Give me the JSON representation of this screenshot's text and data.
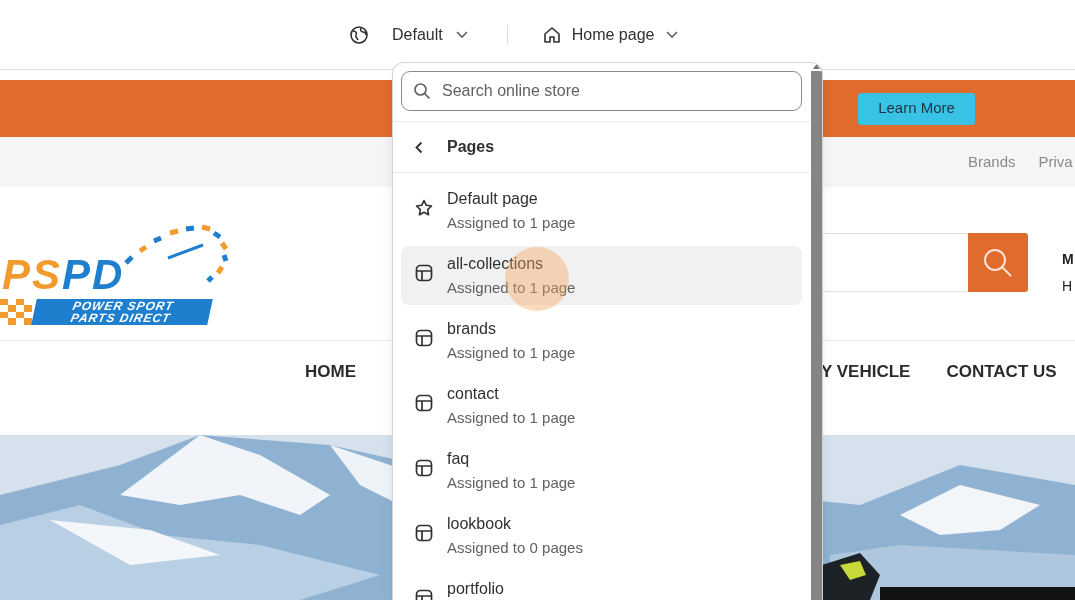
{
  "toolbar": {
    "theme": {
      "label": "Default"
    },
    "template": {
      "label": "Home page"
    }
  },
  "site": {
    "announcement": {
      "button": "Learn More"
    },
    "top_links": [
      "Brands",
      "Priva"
    ],
    "logo": {
      "initials": "PSPD",
      "line_1": "POWER SPORT",
      "line_2": "PARTS DIRECT"
    },
    "header_right": [
      "M",
      "H"
    ],
    "nav": [
      "HOME",
      "Y VEHICLE",
      "CONTACT US"
    ]
  },
  "dropdown": {
    "search": {
      "placeholder": "Search online store"
    },
    "title": "Pages",
    "items": [
      {
        "kind": "default",
        "name": "Default page",
        "assigned": "Assigned to 1 page",
        "selected": false
      },
      {
        "kind": "template",
        "name": "all-collections",
        "assigned": "Assigned to 1 page",
        "selected": true
      },
      {
        "kind": "template",
        "name": "brands",
        "assigned": "Assigned to 1 page",
        "selected": false
      },
      {
        "kind": "template",
        "name": "contact",
        "assigned": "Assigned to 1 page",
        "selected": false
      },
      {
        "kind": "template",
        "name": "faq",
        "assigned": "Assigned to 1 page",
        "selected": false
      },
      {
        "kind": "template",
        "name": "lookbook",
        "assigned": "Assigned to 0 pages",
        "selected": false
      },
      {
        "kind": "template",
        "name": "portfolio",
        "selected": false
      }
    ]
  }
}
